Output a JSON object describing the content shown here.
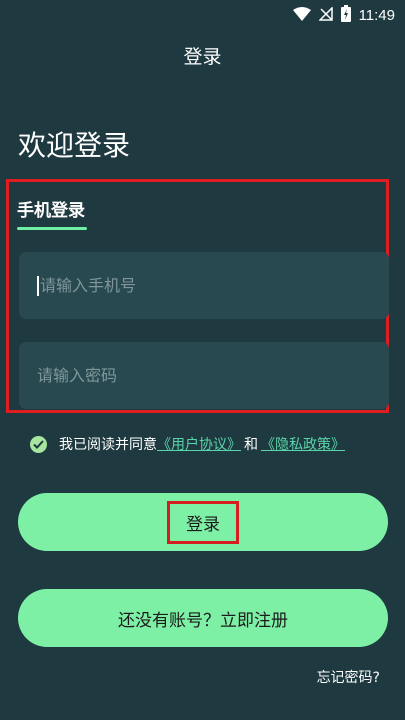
{
  "status_bar": {
    "time": "11:49",
    "icons": [
      "wifi-icon",
      "no-signal-icon",
      "battery-charging-icon"
    ]
  },
  "nav": {
    "title": "登录"
  },
  "welcome": "欢迎登录",
  "login_tab": {
    "label": "手机登录"
  },
  "phone_field": {
    "placeholder": "请输入手机号",
    "value": ""
  },
  "password_field": {
    "placeholder": "请输入密码",
    "value": ""
  },
  "agreement": {
    "checked": true,
    "prefix": "我已阅读并同意",
    "user_agreement": "《用户协议》",
    "conjunction": "和",
    "privacy_policy": "《隐私政策》"
  },
  "buttons": {
    "login": "登录",
    "register": "还没有账号？立即注册"
  },
  "forgot_password": "忘记密码?",
  "colors": {
    "background": "#1e3a40",
    "accent": "#7df0a6",
    "field": "#284950",
    "link": "#5ad4a8",
    "highlight": "#e01e22"
  }
}
